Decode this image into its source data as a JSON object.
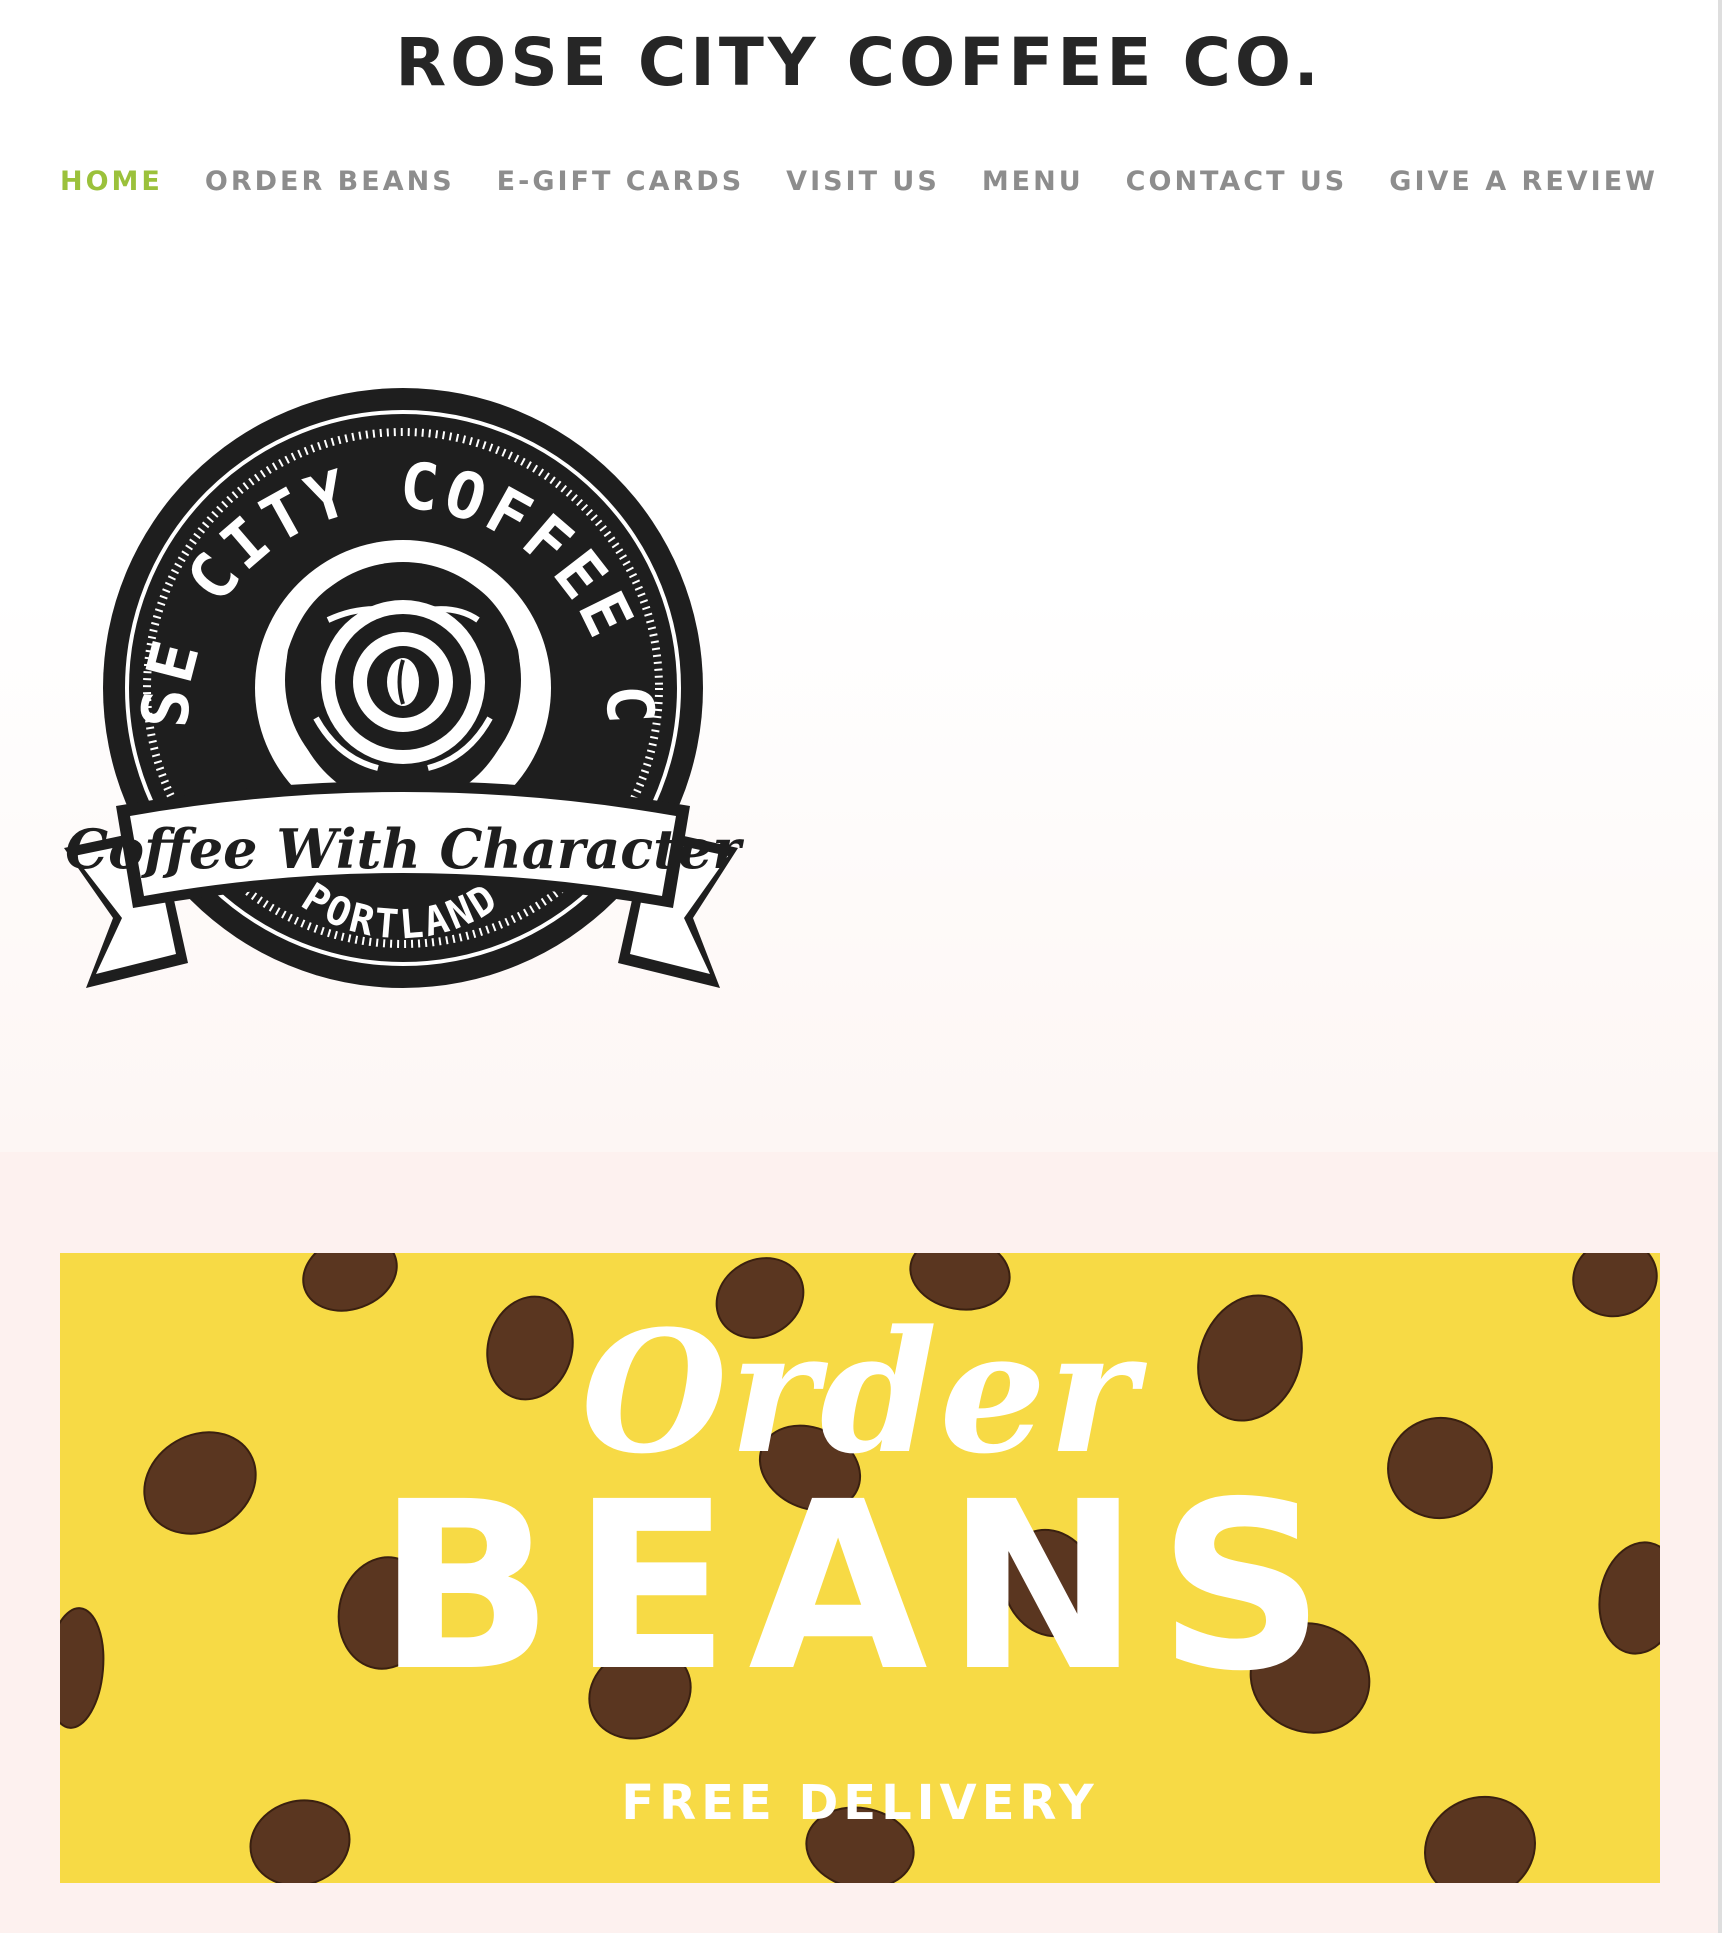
{
  "site": {
    "title": "ROSE CITY COFFEE CO."
  },
  "nav": {
    "items": [
      {
        "label": "HOME",
        "active": true
      },
      {
        "label": "ORDER BEANS",
        "active": false
      },
      {
        "label": "E-GIFT CARDS",
        "active": false
      },
      {
        "label": "VISIT US",
        "active": false
      },
      {
        "label": "MENU",
        "active": false
      },
      {
        "label": "CONTACT US",
        "active": false
      },
      {
        "label": "GIVE A REVIEW",
        "active": false
      }
    ]
  },
  "logo": {
    "arc_text": "ROSE CITY COFFEE CO.",
    "ribbon_text": "Coffee With Character",
    "bottom_text": "PORTLAND"
  },
  "banner": {
    "script_text": "Order",
    "main_text": "BEANS",
    "sub_text": "FREE DELIVERY"
  },
  "colors": {
    "accent": "#9bc13b",
    "nav_text": "#8d8d8d",
    "title_text": "#262626",
    "band_background": "#fdf1ef",
    "banner_background": "#f7da45",
    "logo_ink": "#1e1e1e",
    "bean": "#5a3620"
  }
}
